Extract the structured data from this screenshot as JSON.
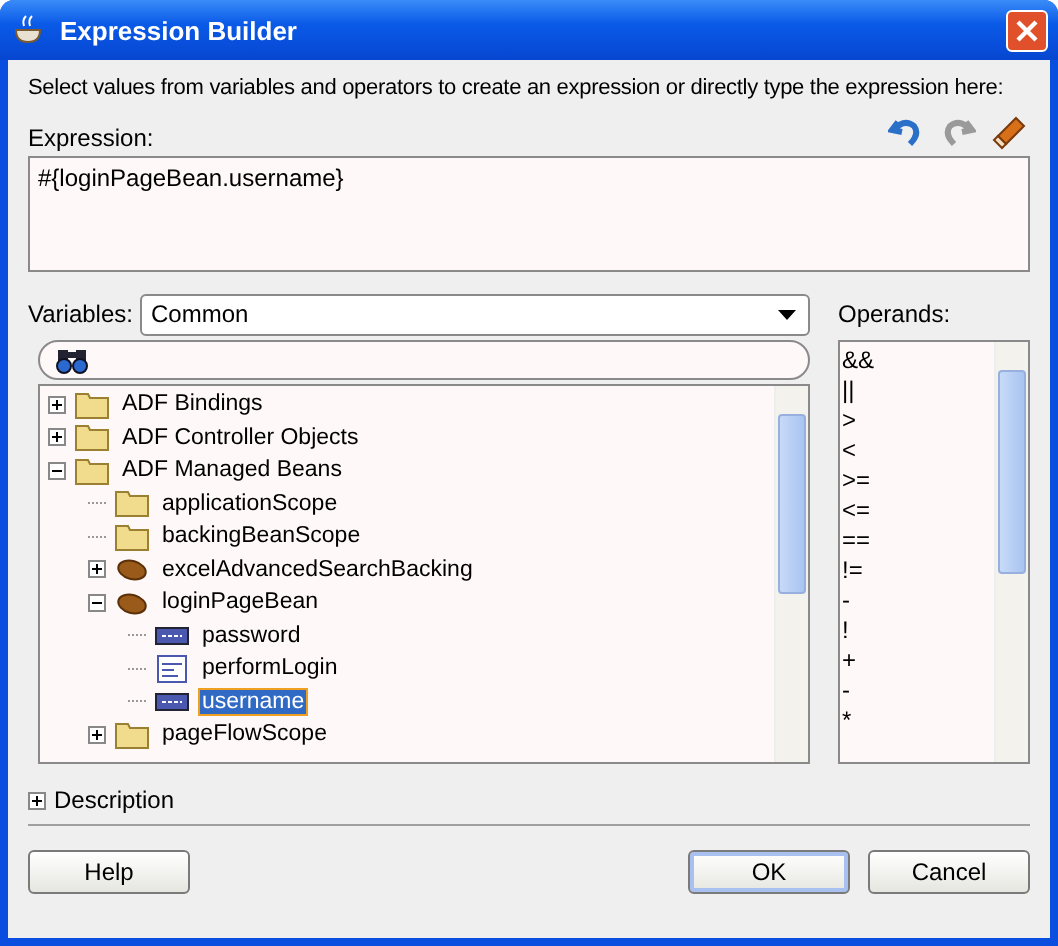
{
  "window": {
    "title": "Expression Builder"
  },
  "instructions": "Select values from variables and operators to create an expression or directly type the expression here:",
  "expression": {
    "label": "Expression:",
    "value": "#{loginPageBean.username}"
  },
  "toolbar": [
    {
      "kind": "undo",
      "disabled": false
    },
    {
      "kind": "redo",
      "disabled": true
    },
    {
      "kind": "clear",
      "disabled": false
    }
  ],
  "variables": {
    "label": "Variables:",
    "value": "Common"
  },
  "tree": [
    {
      "label": "ADF Bindings",
      "kind": "folder",
      "expanded": false,
      "selected": false
    },
    {
      "label": "ADF Controller Objects",
      "kind": "folder",
      "expanded": false,
      "selected": false
    },
    {
      "label": "ADF Managed Beans",
      "kind": "folder",
      "expanded": true,
      "selected": false,
      "children": [
        {
          "label": "applicationScope",
          "kind": "folder",
          "selected": false
        },
        {
          "label": "backingBeanScope",
          "kind": "folder",
          "selected": false
        },
        {
          "label": "excelAdvancedSearchBacking",
          "kind": "bean",
          "expanded": false,
          "selected": false
        },
        {
          "label": "loginPageBean",
          "kind": "bean",
          "expanded": true,
          "selected": false,
          "children": [
            {
              "label": "password",
              "kind": "property",
              "selected": false
            },
            {
              "label": "performLogin",
              "kind": "method",
              "selected": false
            },
            {
              "label": "username",
              "kind": "property",
              "selected": true
            }
          ]
        },
        {
          "label": "pageFlowScope",
          "kind": "folder",
          "expanded": false,
          "selected": false
        }
      ]
    }
  ],
  "operands": {
    "label": "Operands:",
    "items": [
      "&&",
      "||",
      ">",
      "<",
      ">=",
      "<=",
      "==",
      "!=",
      "-",
      "!",
      "+",
      "-",
      "*"
    ]
  },
  "description": {
    "label": "Description",
    "expanded": false
  },
  "buttons": [
    {
      "label": "Help",
      "default": false
    },
    {
      "label": "OK",
      "default": true
    },
    {
      "label": "Cancel",
      "default": false
    }
  ]
}
